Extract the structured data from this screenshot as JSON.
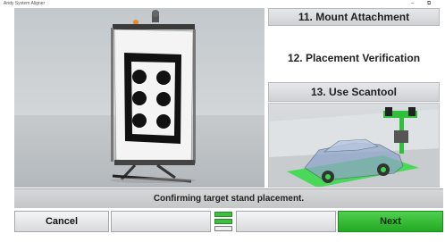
{
  "window": {
    "title": "Andy System Aligner",
    "controls": [
      "–",
      "⧉"
    ]
  },
  "steps": [
    {
      "label": "11. Mount Attachment",
      "state": "inactive"
    },
    {
      "label": "12. Placement Verification",
      "state": "active"
    },
    {
      "label": "13. Use Scantool",
      "state": "inactive"
    }
  ],
  "status": {
    "message": "Confirming target stand placement."
  },
  "buttons": {
    "cancel": "Cancel",
    "blank1": "",
    "blank2": "",
    "next": "Next"
  },
  "progress": {
    "segments": 3,
    "completed": 2
  },
  "colors": {
    "next_green": "#23a923",
    "lidar_green": "#3bd94a",
    "target_black": "#111111"
  },
  "icons": [
    "target-stand-illustration",
    "vehicle-calibration-illustration"
  ]
}
